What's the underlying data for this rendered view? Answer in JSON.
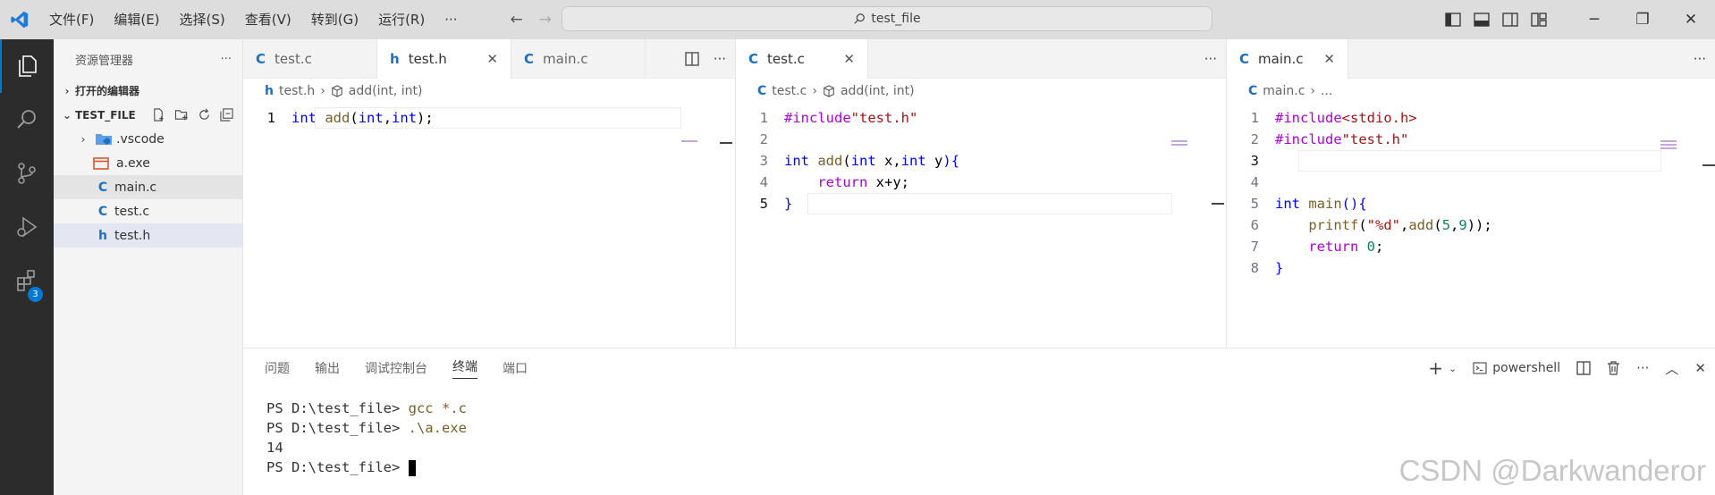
{
  "titlebar": {
    "menus": [
      "文件(F)",
      "编辑(E)",
      "选择(S)",
      "查看(V)",
      "转到(G)",
      "运行(R)",
      "···"
    ],
    "search_text": "test_file",
    "window_buttons": [
      "─",
      "❐",
      "✕"
    ]
  },
  "activitybar": {
    "extensions_badge": "3"
  },
  "sidebar": {
    "title": "资源管理器",
    "more": "···",
    "open_editors": "打开的编辑器",
    "folder": "TEST_FILE",
    "items": [
      {
        "label": ".vscode",
        "icon": "folder-vscode-icon"
      },
      {
        "label": "a.exe",
        "icon": "exe-icon"
      },
      {
        "label": "main.c",
        "icon": "c-file-icon"
      },
      {
        "label": "test.c",
        "icon": "c-file-icon"
      },
      {
        "label": "test.h",
        "icon": "h-file-icon"
      }
    ]
  },
  "group1": {
    "tabs": [
      {
        "icon": "C",
        "label": "test.c"
      },
      {
        "icon": "h",
        "label": "test.h"
      },
      {
        "icon": "C",
        "label": "main.c"
      }
    ],
    "breadcrumb_file": "test.h",
    "breadcrumb_symbol": "add(int, int)",
    "lines": [
      {
        "n": "1"
      }
    ]
  },
  "group2": {
    "tabs": [
      {
        "icon": "C",
        "label": "test.c"
      }
    ],
    "breadcrumb_file": "test.c",
    "breadcrumb_symbol": "add(int, int)",
    "lines": [
      {
        "n": "1"
      },
      {
        "n": "2"
      },
      {
        "n": "3"
      },
      {
        "n": "4"
      },
      {
        "n": "5"
      }
    ]
  },
  "group3": {
    "tabs": [
      {
        "icon": "C",
        "label": "main.c"
      }
    ],
    "breadcrumb_file": "main.c",
    "breadcrumb_symbol": "...",
    "lines": [
      {
        "n": "1"
      },
      {
        "n": "2"
      },
      {
        "n": "3"
      },
      {
        "n": "4"
      },
      {
        "n": "5"
      },
      {
        "n": "6"
      },
      {
        "n": "7"
      },
      {
        "n": "8"
      }
    ]
  },
  "code": {
    "include": "#include",
    "test_h_str": "\"test.h\"",
    "stdio": "<stdio.h>",
    "int": "int",
    "add": "add",
    "return": "return",
    "main": "main",
    "printf": "printf",
    "fmt": "\"%d\"",
    "five": "5",
    "nine": "9",
    "zero": "0"
  },
  "panel": {
    "tabs": [
      "问题",
      "输出",
      "调试控制台",
      "终端",
      "端口"
    ],
    "shell": "powershell",
    "terminal": {
      "prompt": "PS D:\\test_file> ",
      "cmd1": "gcc *.c",
      "cmd2": ".\\a.exe",
      "output": "14"
    }
  },
  "watermark": "CSDN @Darkwanderor"
}
